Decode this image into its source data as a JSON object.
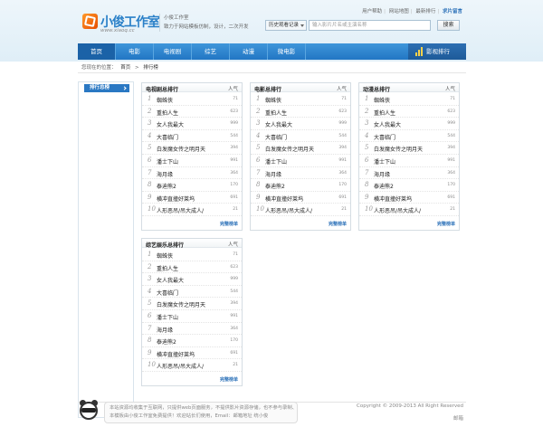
{
  "top_links": [
    "用户帮助",
    "网站地图",
    "最新排行",
    "求片留言"
  ],
  "logo": {
    "name": "小俊工作室",
    "url": "www.xiaoq.cc"
  },
  "slogan": {
    "line1": "小俊工作室",
    "line2": "致力于网站模板仿制，设计，二次开发"
  },
  "search": {
    "select_label": "历史观看记录",
    "placeholder": "输入影片片名或主演名称",
    "button": "搜索"
  },
  "nav": {
    "items": [
      "首页",
      "电影",
      "电视剧",
      "综艺",
      "动漫",
      "微电影"
    ],
    "active": "首页",
    "rank_label": "影视排行"
  },
  "breadcrumb": {
    "prefix": "您现在的位置：",
    "home": "首页",
    "sep": ">",
    "current": "排行榜"
  },
  "sidebar": {
    "header": "排行总榜"
  },
  "panels": [
    {
      "title": "电视剧总排行",
      "heat_label": "人气",
      "more": "完整榜单",
      "rows": [
        {
          "rank": "1",
          "name": "蜘蛛侠",
          "value": "71"
        },
        {
          "rank": "2",
          "name": "重拍人生",
          "value": "623"
        },
        {
          "rank": "3",
          "name": "女人我最大",
          "value": "999"
        },
        {
          "rank": "4",
          "name": "大喜临门",
          "value": "544"
        },
        {
          "rank": "5",
          "name": "白发魔女传之明月天",
          "value": "394"
        },
        {
          "rank": "6",
          "name": "潘士下山",
          "value": "991"
        },
        {
          "rank": "7",
          "name": "海月缘",
          "value": "364"
        },
        {
          "rank": "8",
          "name": "泰迪熊2",
          "value": "170"
        },
        {
          "rank": "9",
          "name": "横冲直撞好莱坞",
          "value": "691"
        },
        {
          "rank": "10",
          "name": "人形恶吊/吊大成人/",
          "value": "21"
        }
      ]
    },
    {
      "title": "电影总排行",
      "heat_label": "人气",
      "more": "完整榜单",
      "rows": [
        {
          "rank": "1",
          "name": "蜘蛛侠",
          "value": "71"
        },
        {
          "rank": "2",
          "name": "重拍人生",
          "value": "623"
        },
        {
          "rank": "3",
          "name": "女人我最大",
          "value": "999"
        },
        {
          "rank": "4",
          "name": "大喜临门",
          "value": "544"
        },
        {
          "rank": "5",
          "name": "白发魔女传之明月天",
          "value": "394"
        },
        {
          "rank": "6",
          "name": "潘士下山",
          "value": "991"
        },
        {
          "rank": "7",
          "name": "海月缘",
          "value": "364"
        },
        {
          "rank": "8",
          "name": "泰迪熊2",
          "value": "170"
        },
        {
          "rank": "9",
          "name": "横冲直撞好莱坞",
          "value": "691"
        },
        {
          "rank": "10",
          "name": "人形恶吊/吊大成人/",
          "value": "21"
        }
      ]
    },
    {
      "title": "动漫总排行",
      "heat_label": "人气",
      "more": "完整榜单",
      "rows": [
        {
          "rank": "1",
          "name": "蜘蛛侠",
          "value": "71"
        },
        {
          "rank": "2",
          "name": "重拍人生",
          "value": "623"
        },
        {
          "rank": "3",
          "name": "女人我最大",
          "value": "999"
        },
        {
          "rank": "4",
          "name": "大喜临门",
          "value": "544"
        },
        {
          "rank": "5",
          "name": "白发魔女传之明月天",
          "value": "394"
        },
        {
          "rank": "6",
          "name": "潘士下山",
          "value": "991"
        },
        {
          "rank": "7",
          "name": "海月缘",
          "value": "364"
        },
        {
          "rank": "8",
          "name": "泰迪熊2",
          "value": "170"
        },
        {
          "rank": "9",
          "name": "横冲直撞好莱坞",
          "value": "691"
        },
        {
          "rank": "10",
          "name": "人形恶吊/吊大成人/",
          "value": "21"
        }
      ]
    },
    {
      "title": "综艺娱乐总排行",
      "heat_label": "人气",
      "more": "完整榜单",
      "rows": [
        {
          "rank": "1",
          "name": "蜘蛛侠",
          "value": "71"
        },
        {
          "rank": "2",
          "name": "重拍人生",
          "value": "623"
        },
        {
          "rank": "3",
          "name": "女人我最大",
          "value": "999"
        },
        {
          "rank": "4",
          "name": "大喜临门",
          "value": "544"
        },
        {
          "rank": "5",
          "name": "白发魔女传之明月天",
          "value": "394"
        },
        {
          "rank": "6",
          "name": "潘士下山",
          "value": "991"
        },
        {
          "rank": "7",
          "name": "海月缘",
          "value": "364"
        },
        {
          "rank": "8",
          "name": "泰迪熊2",
          "value": "170"
        },
        {
          "rank": "9",
          "name": "横冲直撞好莱坞",
          "value": "691"
        },
        {
          "rank": "10",
          "name": "人形恶吊/吊大成人/",
          "value": "21"
        }
      ]
    }
  ],
  "footer": {
    "notice_line1": "本站资源均收集于互联网，只提供web页面服务，不提供影片资源存储，也不参与录制、上传！",
    "notice_line2": "本模板由小俊工作室免费提供！欢迎站长们使用，Email：邮箱地址  统小俊",
    "copyright": "Copyright © 2009-2013 All Right Reserved",
    "mail_label": "邮箱"
  },
  "colors": {
    "accent": "#2a78c3",
    "nav_bg": "#2a80cc",
    "link": "#2a70b8"
  }
}
